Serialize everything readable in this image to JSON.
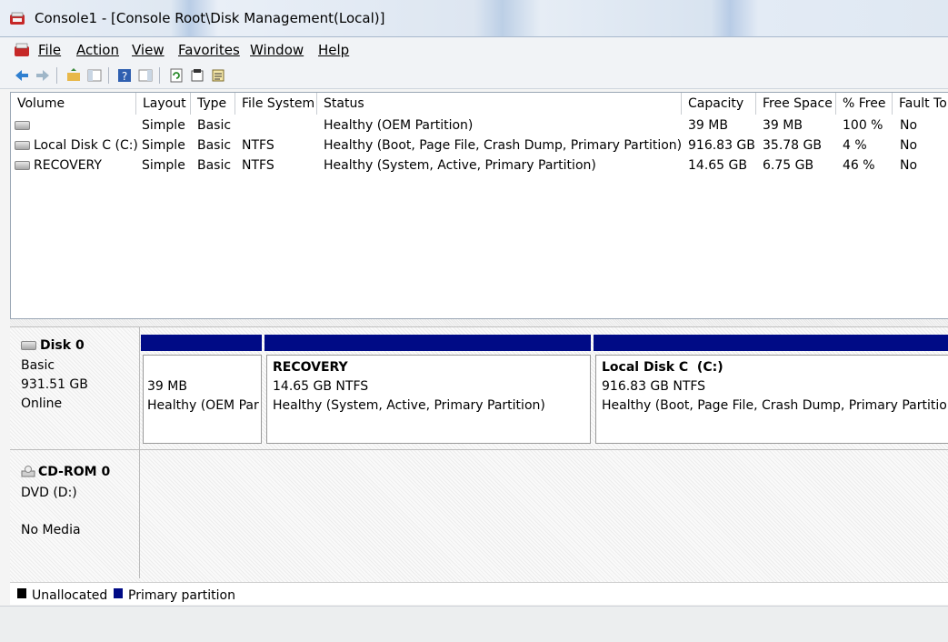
{
  "window": {
    "title": "Console1 - [Console Root\\Disk Management(Local)]"
  },
  "menu": {
    "file": "File",
    "action": "Action",
    "view": "View",
    "favorites": "Favorites",
    "window": "Window",
    "help": "Help"
  },
  "columns": {
    "volume": "Volume",
    "layout": "Layout",
    "type": "Type",
    "file_system": "File System",
    "status": "Status",
    "capacity": "Capacity",
    "free_space": "Free Space",
    "percent_free": "% Free",
    "fault_tolerance": "Fault To"
  },
  "volumes": [
    {
      "name": "",
      "layout": "Simple",
      "type": "Basic",
      "fs": "",
      "status": "Healthy (OEM Partition)",
      "capacity": "39 MB",
      "free": "39 MB",
      "pct": "100 %",
      "fault": "No"
    },
    {
      "name": "Local Disk C (C:)",
      "layout": "Simple",
      "type": "Basic",
      "fs": "NTFS",
      "status": "Healthy (Boot, Page File, Crash Dump, Primary Partition)",
      "capacity": "916.83 GB",
      "free": "35.78 GB",
      "pct": "4 %",
      "fault": "No"
    },
    {
      "name": "RECOVERY",
      "layout": "Simple",
      "type": "Basic",
      "fs": "NTFS",
      "status": "Healthy (System, Active, Primary Partition)",
      "capacity": "14.65 GB",
      "free": "6.75 GB",
      "pct": "46 %",
      "fault": "No"
    }
  ],
  "disk0": {
    "name": "Disk 0",
    "type": "Basic",
    "size": "931.51 GB",
    "state": "Online",
    "partitions": [
      {
        "title": "",
        "size": "39 MB",
        "status": "Healthy (OEM Par"
      },
      {
        "title": "RECOVERY",
        "size": "14.65 GB NTFS",
        "status": "Healthy (System, Active, Primary Partition)"
      },
      {
        "title": "Local Disk C  (C:)",
        "size": "916.83 GB NTFS",
        "status": "Healthy (Boot, Page File, Crash Dump, Primary Partition"
      }
    ]
  },
  "cdrom0": {
    "name": "CD-ROM 0",
    "drive": "DVD (D:)",
    "media": "No Media"
  },
  "legend": {
    "unallocated": "Unallocated",
    "primary": "Primary partition"
  },
  "colors": {
    "primary_partition": "#000b86",
    "unallocated": "#000000"
  }
}
